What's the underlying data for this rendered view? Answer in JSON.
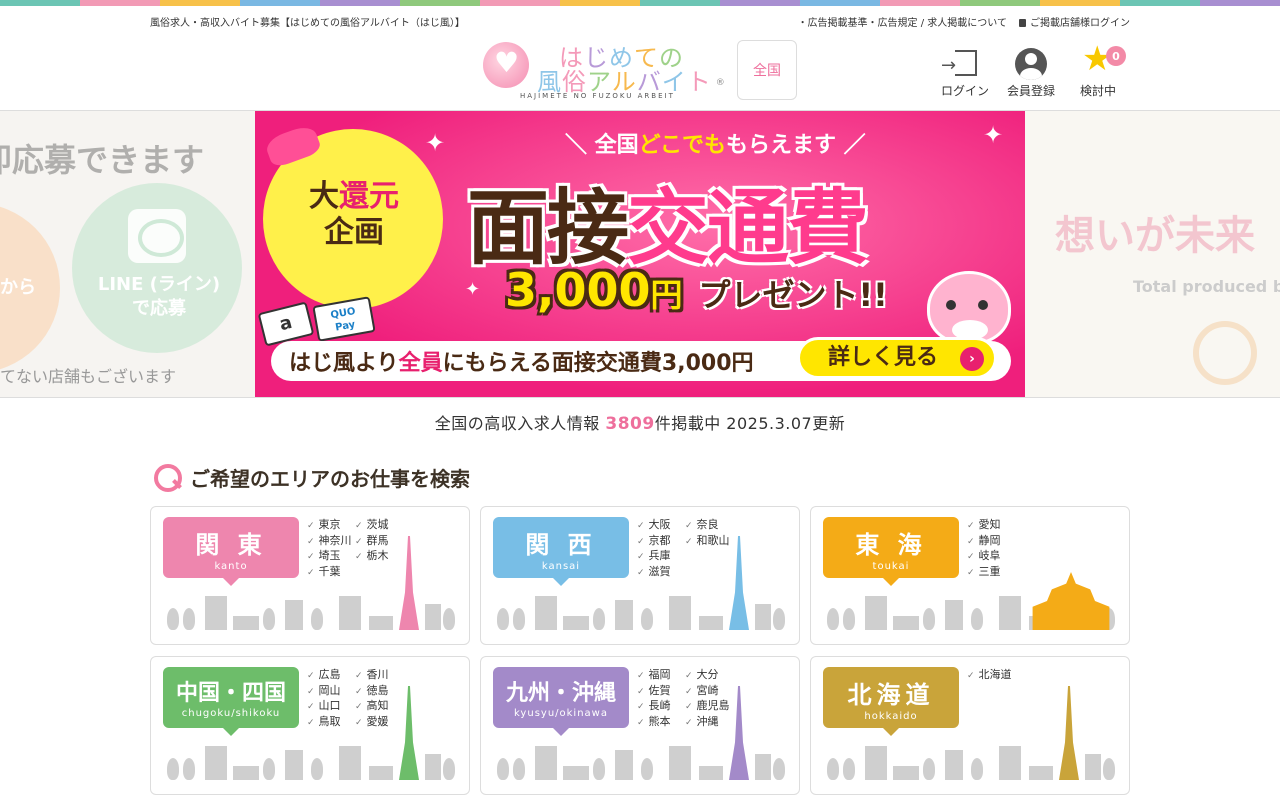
{
  "colors": {
    "accent": "#ee6f9c",
    "stripe": [
      "#6cc5b4",
      "#f29ab5",
      "#f7c14a",
      "#7ab8e3",
      "#a88fd1",
      "#8fc97c",
      "#f29ab5",
      "#f7c14a",
      "#6cc5b4",
      "#a88fd1",
      "#7ab8e3",
      "#f29ab5",
      "#8fc97c",
      "#f7c14a",
      "#6cc5b4",
      "#a88fd1"
    ],
    "kanto": "#ee86ae",
    "kansai": "#78bee6",
    "tokai": "#f4ab17",
    "chugoku": "#6dbd6a",
    "kyushu": "#a38ac9",
    "hokkaido": "#c9a43a"
  },
  "topbar": {
    "tagline": "風俗求人・高収入バイト募集【はじめての風俗アルバイト（はじ風）】",
    "links": [
      "・広告掲載基準・広告規定 / 求人掲載について"
    ],
    "shop_login": "ご掲載店舗様ログイン"
  },
  "logo": {
    "line1": "はじめての",
    "line2": "風俗アルバイト",
    "romaji": "HAJIMETE NO FUZOKU ARBEIT",
    "reg": "®"
  },
  "header": {
    "area_label": "全国",
    "login_label": "ログイン",
    "register_label": "会員登録",
    "favorites_label": "検討中",
    "favorites_count": "0"
  },
  "hero": {
    "left": {
      "headline": "即応募できます",
      "circle_left": "から",
      "circle_right": "LINE (ライン)\nで応募",
      "note": "てない店舗もございます"
    },
    "right": {
      "headline": "想いが未来",
      "sub": "Total produced by"
    },
    "banner": {
      "header_pre": "＼ 全国",
      "header_hl": "どこでも",
      "header_post": "もらえます ／",
      "burst_line1_a": "大",
      "burst_line1_b": "還元",
      "burst_line2": "企画",
      "big_a": "面接",
      "big_b": "交通費",
      "amount": "3,000",
      "amount_unit": "円",
      "amount_suffix": "プレゼント!!",
      "card_amazon": "a",
      "card_quo": "QUO\nPay",
      "bar_a": "はじ風より",
      "bar_b": "全員",
      "bar_c": "にもらえる面接交通費3,000円",
      "cta": "詳しく見る",
      "cta_arrow": "›"
    }
  },
  "status": {
    "pre": "全国の高収入求人情報",
    "count": "3809",
    "post": "件掲載中 2025.3.07更新"
  },
  "search": {
    "title": "ご希望のエリアのお仕事を検索"
  },
  "regions": [
    {
      "jp": "関 東",
      "en": "kanto",
      "prefs": [
        "東京",
        "神奈川",
        "埼玉",
        "千葉",
        "茨城",
        "群馬",
        "栃木"
      ]
    },
    {
      "jp": "関 西",
      "en": "kansai",
      "prefs": [
        "大阪",
        "京都",
        "兵庫",
        "滋賀",
        "奈良",
        "和歌山"
      ]
    },
    {
      "jp": "東 海",
      "en": "toukai",
      "prefs": [
        "愛知",
        "静岡",
        "岐阜",
        "三重"
      ]
    },
    {
      "jp": "中国・四国",
      "en": "chugoku/shikoku",
      "prefs": [
        "広島",
        "岡山",
        "山口",
        "鳥取",
        "香川",
        "徳島",
        "高知",
        "愛媛"
      ]
    },
    {
      "jp": "九州・沖縄",
      "en": "kyusyu/okinawa",
      "prefs": [
        "福岡",
        "佐賀",
        "長崎",
        "熊本",
        "大分",
        "宮崎",
        "鹿児島",
        "沖縄"
      ]
    },
    {
      "jp": "北海道",
      "en": "hokkaido",
      "prefs": [
        "北海道"
      ]
    }
  ]
}
